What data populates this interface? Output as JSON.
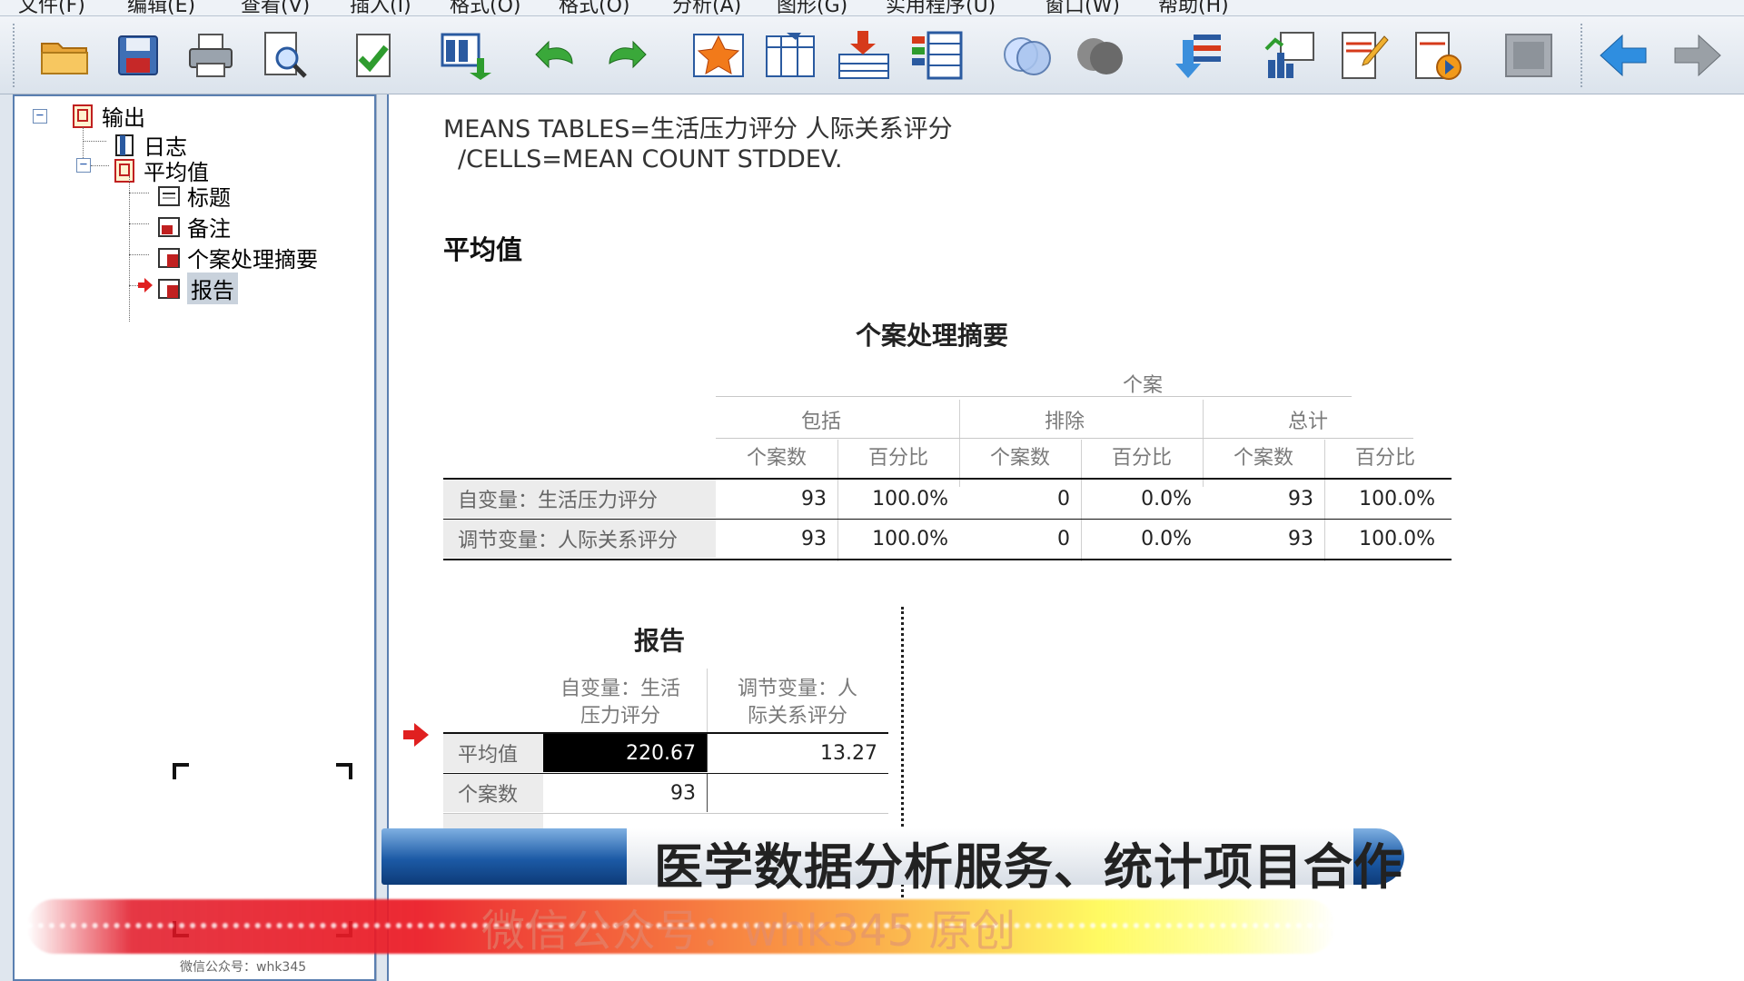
{
  "menu": [
    "文件(F)",
    "编辑(E)",
    "查看(V)",
    "插入(I)",
    "格式(O)",
    "格式(O)",
    "分析(A)",
    "图形(G)",
    "实用程序(U)",
    "窗口(W)",
    "帮助(H)"
  ],
  "toolbar": {
    "icons": [
      "open-folder-icon",
      "save-icon",
      "print-icon",
      "print-preview-icon",
      "export-icon",
      "recall-dialog-icon",
      "undo-icon",
      "redo-icon",
      "goto-case-icon",
      "goto-variable-icon",
      "insert-output-icon",
      "insert-table-icon",
      "show-all-icon",
      "hide-icon",
      "promote-icon",
      "insert-chart-icon",
      "insert-text-icon",
      "insert-script-icon",
      "designate-window-icon",
      "back-icon",
      "forward-icon"
    ]
  },
  "nav": {
    "root": "输出",
    "log": "日志",
    "means": "平均值",
    "title": "标题",
    "notes": "备注",
    "case_summary": "个案处理摘要",
    "report": "报告",
    "footer_text": "微信公众号：whk345"
  },
  "content": {
    "syntax_line1": "MEANS TABLES=生活压力评分 人际关系评分",
    "syntax_line2": "/CELLS=MEAN COUNT STDDEV.",
    "heading": "平均值",
    "case_table": {
      "title": "个案处理摘要",
      "group_header": "个案",
      "col_groups": [
        "包括",
        "排除",
        "总计"
      ],
      "col_sub": [
        "个案数",
        "百分比",
        "个案数",
        "百分比",
        "个案数",
        "百分比"
      ],
      "rows": [
        {
          "label": "自变量：生活压力评分",
          "values": [
            "93",
            "100.0%",
            "0",
            "0.0%",
            "93",
            "100.0%"
          ]
        },
        {
          "label": "调节变量：人际关系评分",
          "values": [
            "93",
            "100.0%",
            "0",
            "0.0%",
            "93",
            "100.0%"
          ]
        }
      ]
    },
    "report_table": {
      "title": "报告",
      "col1_header_l1": "自变量：生活",
      "col1_header_l2": "压力评分",
      "col2_header_l1": "调节变量：人",
      "col2_header_l2": "际关系评分",
      "rows": [
        {
          "label": "平均值",
          "v1": "220.67",
          "v2": "13.27"
        },
        {
          "label": "个案数",
          "v1": "93",
          "v2": ""
        }
      ]
    }
  },
  "overlay": {
    "banner_text": "医学数据分析服务、统计项目合作",
    "watermark": "微信公众号：whk345 原创"
  },
  "colors": {
    "nav_border": "#5a7fb0",
    "selected_cell": "#000000",
    "banner_blue": "#1c5aa6",
    "arrow_red": "#e02020"
  }
}
